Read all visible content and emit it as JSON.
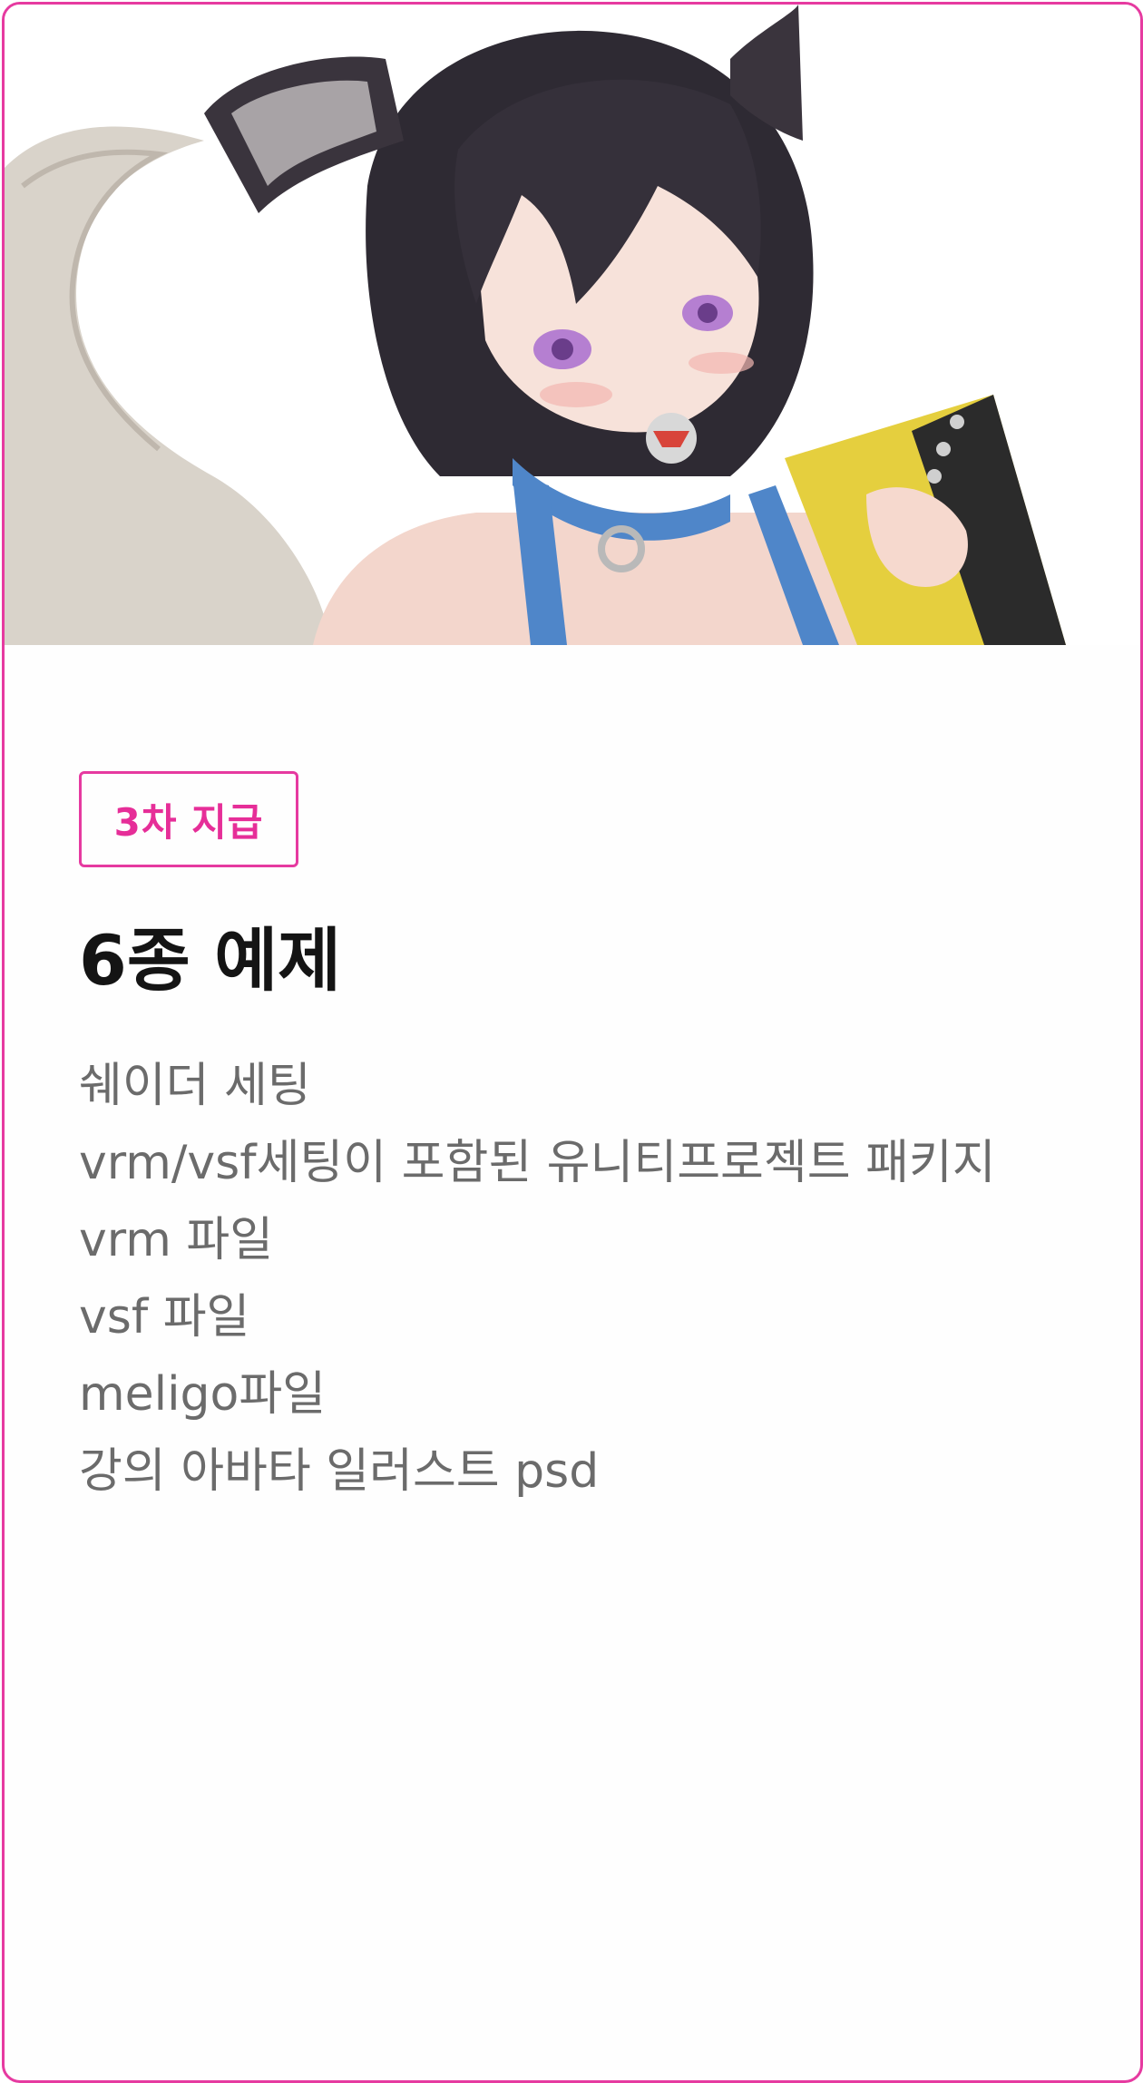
{
  "badge": {
    "label": "3차 지급"
  },
  "title": "6종 예제",
  "items": [
    "쉐이더 세팅",
    "vrm/vsf세팅이 포함된 유니티프로젝트 패키지",
    "vrm 파일",
    "vsf 파일",
    "meligo파일",
    "강의 아바타 일러스트 psd"
  ],
  "colors": {
    "accent": "#e63aa0",
    "title": "#141414",
    "item_text": "#6b6b6b"
  }
}
